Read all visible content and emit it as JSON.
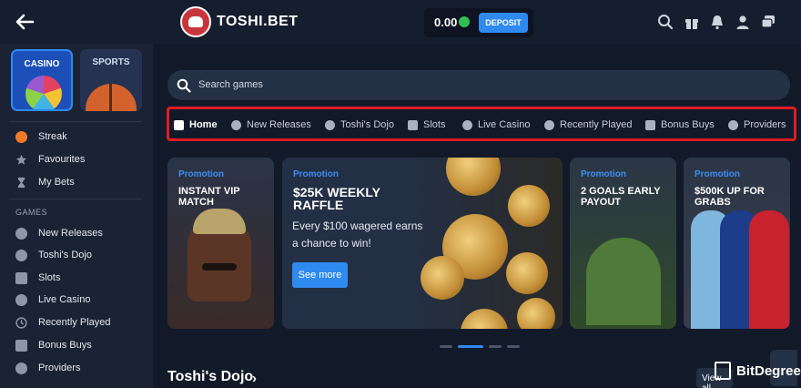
{
  "header": {
    "logo_text": "TOSHI.BET",
    "balance": "0.00",
    "deposit_label": "DEPOSIT",
    "icons": [
      "search-icon",
      "gift-icon",
      "bell-icon",
      "user-icon",
      "chat-icon"
    ]
  },
  "sidebar": {
    "tabs": [
      {
        "label": "CASINO",
        "active": true
      },
      {
        "label": "SPORTS",
        "active": false
      }
    ],
    "top_items": [
      {
        "label": "Streak",
        "icon": "fire-icon"
      },
      {
        "label": "Favourites",
        "icon": "star-icon"
      },
      {
        "label": "My Bets",
        "icon": "hourglass-icon"
      }
    ],
    "games_heading": "GAMES",
    "game_items": [
      {
        "label": "New Releases",
        "icon": "new-releases-icon"
      },
      {
        "label": "Toshi's Dojo",
        "icon": "dojo-icon"
      },
      {
        "label": "Slots",
        "icon": "slots-icon"
      },
      {
        "label": "Live Casino",
        "icon": "live-casino-icon"
      },
      {
        "label": "Recently Played",
        "icon": "clock-icon"
      },
      {
        "label": "Bonus Buys",
        "icon": "bonus-buys-icon"
      },
      {
        "label": "Providers",
        "icon": "providers-icon"
      }
    ]
  },
  "search": {
    "placeholder": "Search games"
  },
  "categories": [
    {
      "label": "Home",
      "active": true
    },
    {
      "label": "New Releases",
      "active": false
    },
    {
      "label": "Toshi's Dojo",
      "active": false
    },
    {
      "label": "Slots",
      "active": false
    },
    {
      "label": "Live Casino",
      "active": false
    },
    {
      "label": "Recently Played",
      "active": false
    },
    {
      "label": "Bonus Buys",
      "active": false
    },
    {
      "label": "Providers",
      "active": false
    }
  ],
  "promos": [
    {
      "tag": "Promotion",
      "title_lines": [
        "INSTANT VIP",
        "MATCH"
      ]
    },
    {
      "tag": "Promotion",
      "title_lines": [
        "$25K WEEKLY",
        "RAFFLE"
      ],
      "description": "Every $100 wagered earns a chance to win!",
      "cta": "See more"
    },
    {
      "tag": "Promotion",
      "title_lines": [
        "2 GOALS EARLY",
        "PAYOUT"
      ]
    },
    {
      "tag": "Promotion",
      "title_lines": [
        "$500K UP FOR",
        "GRABS"
      ]
    }
  ],
  "carousel": {
    "slides": 4,
    "active_index": 1
  },
  "section": {
    "title": "Toshi's Dojo",
    "view_all": "View all"
  },
  "watermark": "BitDegree",
  "colors": {
    "accent": "#2f8af0",
    "highlight_frame": "#e01b24",
    "background": "#121a29",
    "sidebar": "#1a2334"
  }
}
